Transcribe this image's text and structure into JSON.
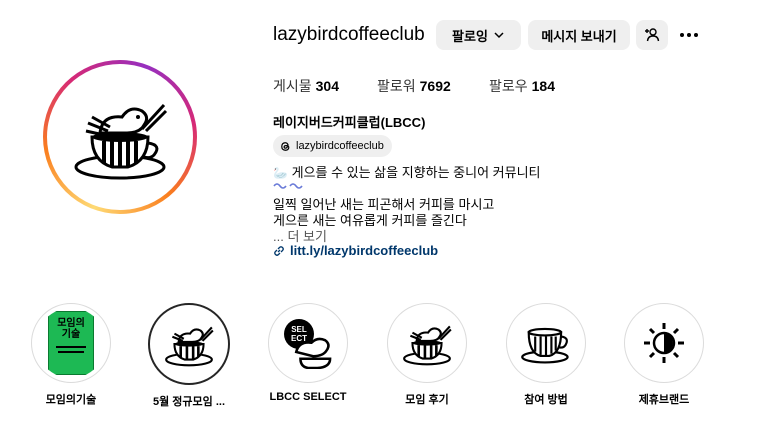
{
  "profile": {
    "username": "lazybirdcoffeeclub",
    "follow_button": "팔로잉",
    "message_button": "메시지 보내기",
    "stats": [
      {
        "label": "게시물",
        "value": "304"
      },
      {
        "label": "팔로워",
        "value": "7692"
      },
      {
        "label": "팔로우",
        "value": "184"
      }
    ],
    "full_name": "레이지버드커피클럽(LBCC)",
    "threads_handle": "lazybirdcoffeeclub",
    "bio_line1": "게으를 수 있는 삶을 지향하는 중니어 커뮤니티",
    "bio_line3": "일찍 일어난 새는 피곤해서 커피를 마시고",
    "bio_line4": "게으른 새는 여유롭게 커피를 즐긴다",
    "more_text": "... 더 보기",
    "link": "litt.ly/lazybirdcoffeeclub"
  },
  "highlights": [
    {
      "label": "모임의기술",
      "cover_text_1": "모임의",
      "cover_text_2": "기술"
    },
    {
      "label": "5월 정규모임 ..."
    },
    {
      "label": "LBCC SELECT",
      "cover_text_1": "SEL",
      "cover_text_2": "ECT"
    },
    {
      "label": "모임 후기"
    },
    {
      "label": "참여 방법"
    },
    {
      "label": "제휴브랜드"
    }
  ]
}
